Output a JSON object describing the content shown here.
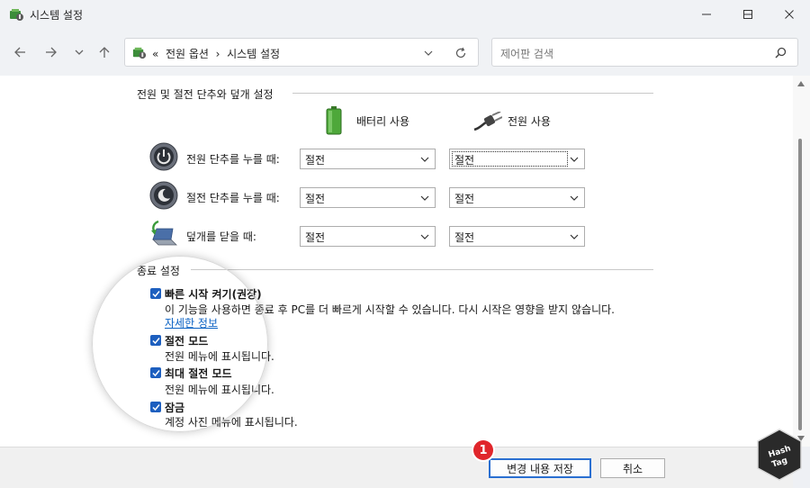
{
  "window": {
    "title": "시스템 설정",
    "accent": "#1d5fbf"
  },
  "nav": {
    "breadcrumb_chevrons": "«",
    "breadcrumb_parent": "전원 옵션",
    "breadcrumb_sep": "›",
    "breadcrumb_current": "시스템 설정",
    "search_placeholder": "제어판 검색"
  },
  "power_group": {
    "title": "전원 및 절전 단추와 덮개 설정",
    "col_battery": "배터리 사용",
    "col_plugged": "전원 사용",
    "rows": [
      {
        "label": "전원 단추를 누를 때:",
        "battery": "절전",
        "plugged": "절전"
      },
      {
        "label": "절전 단추를 누를 때:",
        "battery": "절전",
        "plugged": "절전"
      },
      {
        "label": "덮개를 닫을 때:",
        "battery": "절전",
        "plugged": "절전"
      }
    ]
  },
  "shutdown_group": {
    "title": "종료 설정",
    "options": [
      {
        "title": "빠른 시작 켜기(권장)",
        "checked": true,
        "desc": "이 기능을 사용하면 종료 후 PC를 더 빠르게 시작할 수 있습니다. 다시 시작은 영향을 받지 않습니다.",
        "link": "자세한 정보"
      },
      {
        "title": "절전 모드",
        "checked": true,
        "desc": "전원 메뉴에 표시됩니다."
      },
      {
        "title": "최대 절전 모드",
        "checked": true,
        "desc": "전원 메뉴에 표시됩니다."
      },
      {
        "title": "잠금",
        "checked": true,
        "desc": "계정 사진 메뉴에 표시됩니다."
      }
    ]
  },
  "footer": {
    "save_label": "변경 내용 저장",
    "cancel_label": "취소",
    "marker": "1"
  },
  "watermark": {
    "line1": "Hash",
    "line2": "Tag"
  }
}
